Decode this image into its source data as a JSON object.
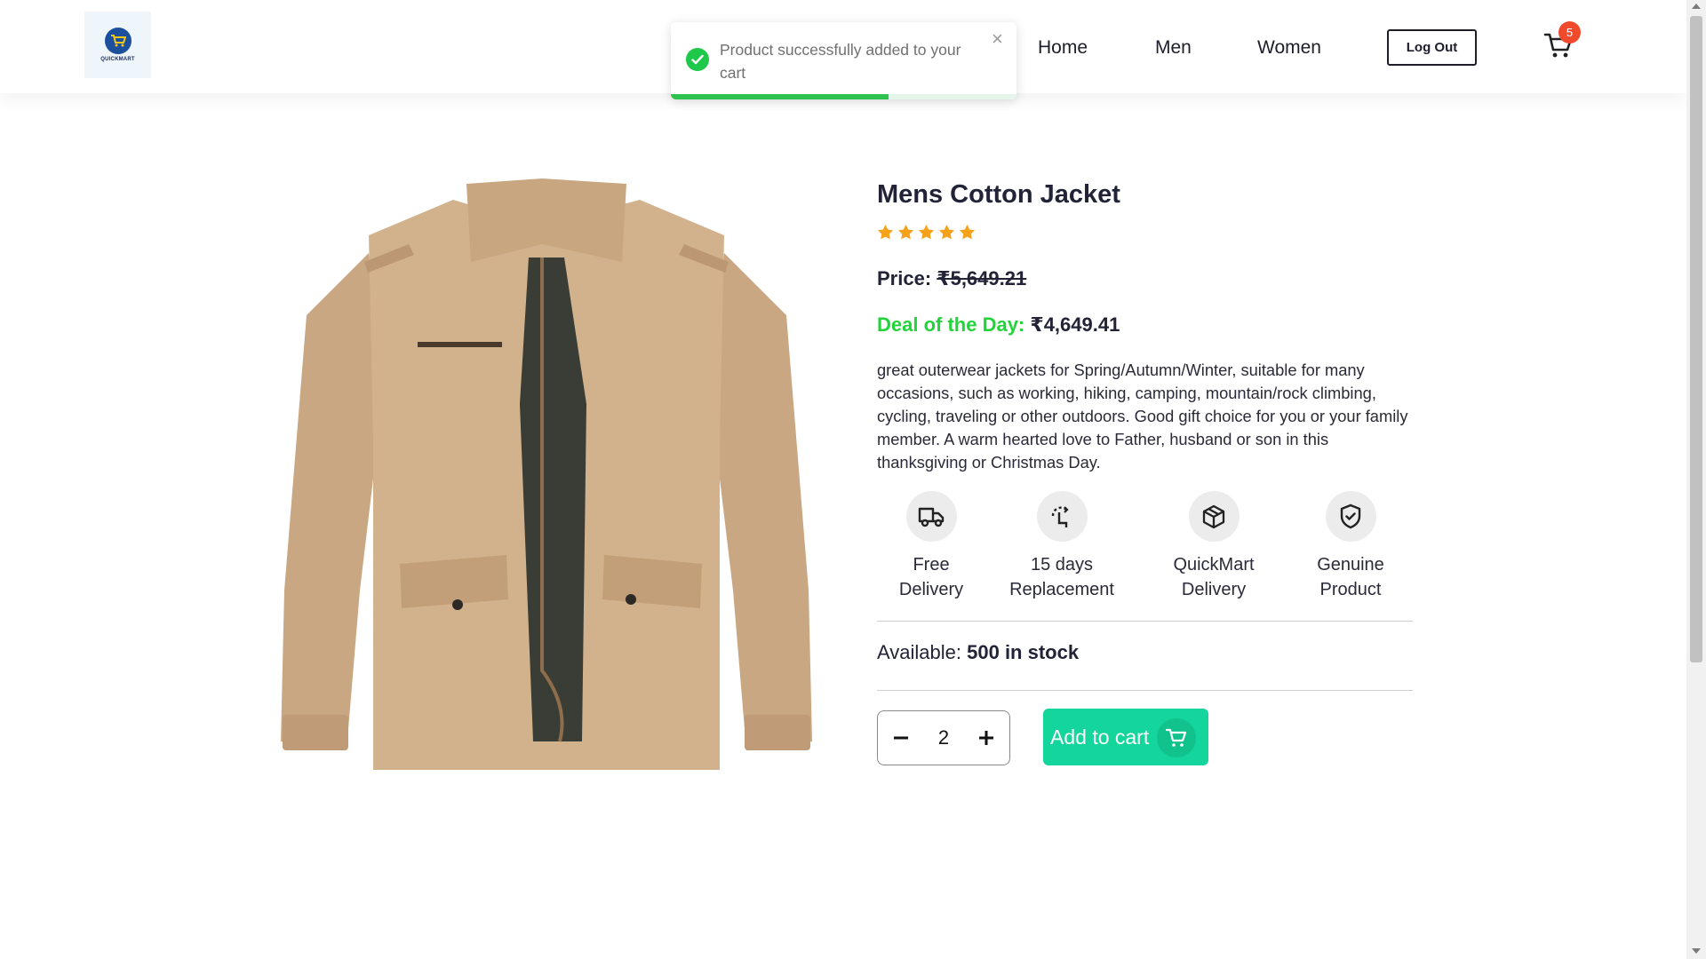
{
  "header": {
    "logo_text": "QUICKMART",
    "nav": [
      {
        "label": "Home"
      },
      {
        "label": "Men"
      },
      {
        "label": "Women"
      }
    ],
    "logout_label": "Log Out",
    "cart_count": "5"
  },
  "toast": {
    "message": "Product successfully added to your cart",
    "close_glyph": "×",
    "progress": 0.63
  },
  "product": {
    "name": "Mens Cotton Jacket",
    "rating": 5,
    "price_label": "Price:",
    "original_price": "₹5,649.21",
    "deal_label": "Deal of the Day:",
    "deal_price": "₹4,649.41",
    "description": "great outerwear jackets for Spring/Autumn/Winter, suitable for many occasions, such as working, hiking, camping, mountain/rock climbing, cycling, traveling or other outdoors. Good gift choice for you or your family member. A warm hearted love to Father, husband or son in this thanksgiving or Christmas Day.",
    "features": [
      {
        "icon": "truck-icon",
        "line1": "Free",
        "line2": "Delivery"
      },
      {
        "icon": "replacement-icon",
        "line1": "15 days",
        "line2": "Replacement"
      },
      {
        "icon": "package-icon",
        "line1": "QuickMart",
        "line2": "Delivery"
      },
      {
        "icon": "shield-check-icon",
        "line1": "Genuine",
        "line2": "Product"
      }
    ],
    "available_label": "Available:",
    "available_value": "500 in stock",
    "quantity": "2",
    "add_to_cart_label": "Add to cart"
  },
  "colors": {
    "accent": "#14d59b",
    "deal": "#22d43a",
    "star": "#f6a11a",
    "badge": "#f04a2d",
    "toast_progress": "#2ec24f"
  }
}
